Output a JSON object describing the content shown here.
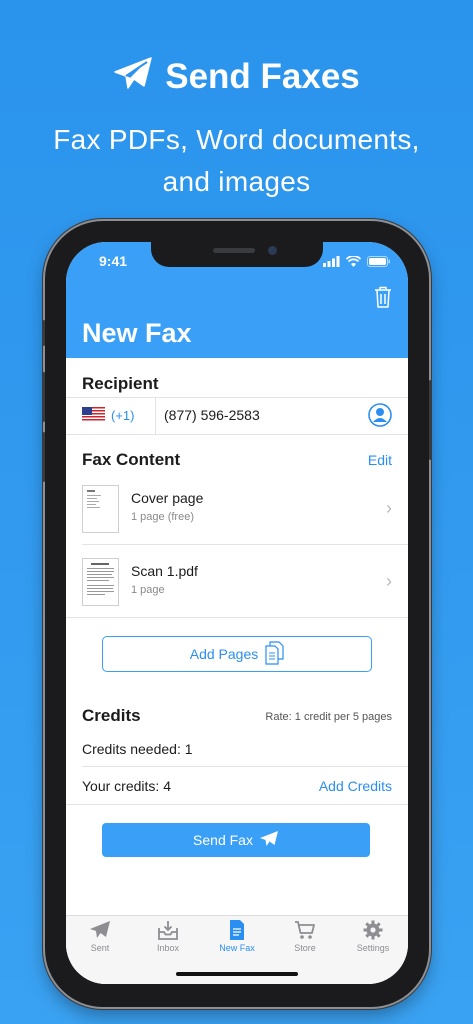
{
  "promo": {
    "title": "Send Faxes",
    "subtitle_line1": "Fax PDFs, Word documents,",
    "subtitle_line2": "and images"
  },
  "status_bar": {
    "time": "9:41"
  },
  "header": {
    "title": "New Fax",
    "trash_icon": "trash-icon"
  },
  "recipient": {
    "heading": "Recipient",
    "country_code": "(+1)",
    "phone_number": "(877) 596-2583",
    "flag_icon": "us-flag-icon",
    "contact_icon": "contact-icon"
  },
  "fax_content": {
    "heading": "Fax Content",
    "edit_label": "Edit",
    "items": [
      {
        "name": "Cover page",
        "pages": "1 page (free)"
      },
      {
        "name": "Scan 1.pdf",
        "pages": "1 page"
      }
    ],
    "add_pages_label": "Add Pages"
  },
  "credits": {
    "heading": "Credits",
    "rate": "Rate: 1 credit per 5 pages",
    "needed": "Credits needed: 1",
    "yours": "Your credits: 4",
    "add_credits_label": "Add Credits"
  },
  "send_button_label": "Send Fax",
  "tabs": [
    {
      "label": "Sent",
      "icon": "paper-plane-icon"
    },
    {
      "label": "Inbox",
      "icon": "inbox-icon"
    },
    {
      "label": "New Fax",
      "icon": "document-icon"
    },
    {
      "label": "Store",
      "icon": "cart-icon"
    },
    {
      "label": "Settings",
      "icon": "gear-icon"
    }
  ],
  "colors": {
    "accent": "#3aa0f7",
    "link": "#2b8ff2",
    "background": "#2a93ec"
  }
}
